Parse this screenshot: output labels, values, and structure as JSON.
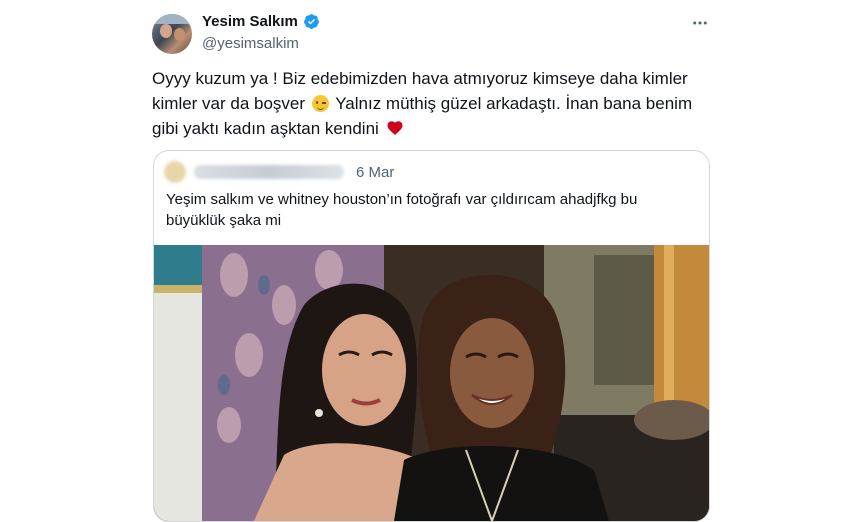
{
  "author": {
    "display_name": "Yesim Salkım",
    "handle": "@yesimsalkim",
    "verified": true
  },
  "icons": {
    "verified": "verified-badge-icon",
    "more": "more-options-icon",
    "wink": "winking-face-emoji",
    "heart": "red-heart-emoji"
  },
  "tweet": {
    "text_part1": "Oyyy kuzum ya ! Biz edebimizden hava atmıyoruz kimseye daha kimler kimler var da boşver",
    "text_part2": "Yalnız müthiş güzel arkadaştı. İnan bana benim gibi yaktı kadın aşktan kendini"
  },
  "quoted_tweet": {
    "date": "6 Mar",
    "text": "Yeşim salkım ve whitney houston’ın fotoğrafı var çıldırıcam ahadjfkg bu büyüklük şaka mi"
  },
  "colors": {
    "verified": "#1d9bf0",
    "text": "#0f1419",
    "secondary": "#536471",
    "border": "#cfd9de",
    "heart": "#d0021b"
  }
}
